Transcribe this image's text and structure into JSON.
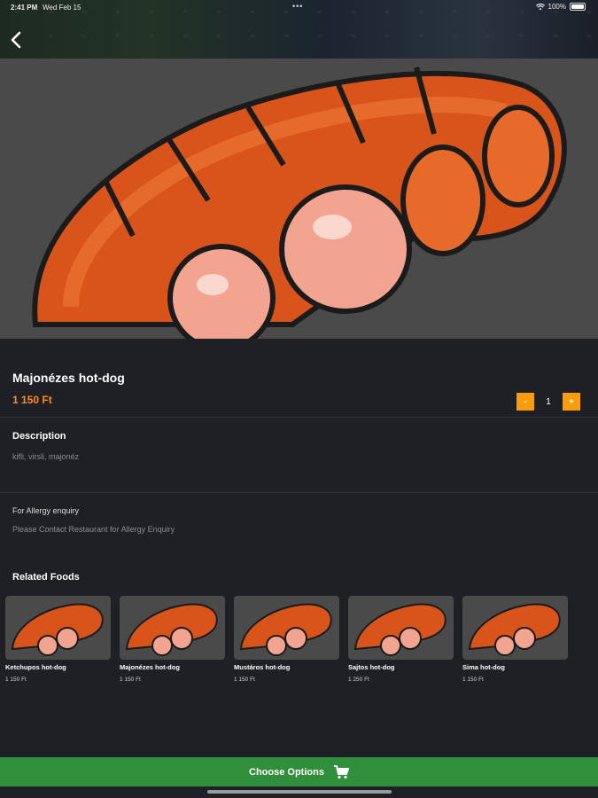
{
  "status_bar": {
    "time": "2:41 PM",
    "date": "Wed Feb 15",
    "dots": "•••",
    "battery": "100%"
  },
  "product": {
    "name": "Majonézes hot-dog",
    "price": "1 150 Ft",
    "quantity": "1",
    "minus_label": "-",
    "plus_label": "+"
  },
  "description": {
    "heading": "Description",
    "text": "kifli, virsli, majonéz"
  },
  "allergy": {
    "heading": "For Allergy enquiry",
    "text": "Please Contact Restaurant for Allergy Enquiry"
  },
  "related": {
    "heading": "Related Foods",
    "items": [
      {
        "name": "Ketchupos hot-dog",
        "price": "1 150 Ft"
      },
      {
        "name": "Majonézes hot-dog",
        "price": "1 150 Ft"
      },
      {
        "name": "Mustáros hot-dog",
        "price": "1 150 Ft"
      },
      {
        "name": "Sajtos hot-dog",
        "price": "1 250 Ft"
      },
      {
        "name": "Sima hot-dog",
        "price": "1 150 Ft"
      }
    ]
  },
  "cta": {
    "label": "Choose Options"
  },
  "icons": {
    "back": "chevron-left-icon",
    "cart": "shopping-cart-icon",
    "wifi": "wifi-icon",
    "battery": "battery-icon"
  },
  "colors": {
    "accent": "#ff8a1f",
    "qty_button": "#f99d0c",
    "cta": "#2f8f3a",
    "background": "#1f2026"
  }
}
